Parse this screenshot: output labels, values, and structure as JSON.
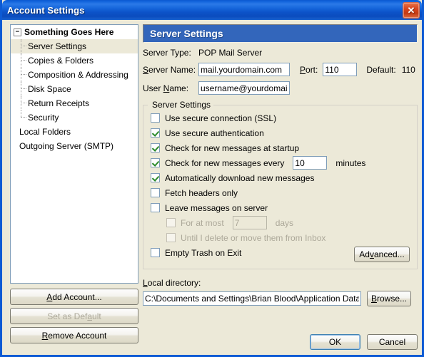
{
  "window": {
    "title": "Account Settings",
    "close_label": "✕"
  },
  "sidebar": {
    "tree": [
      {
        "label": "Something Goes Here",
        "level": 0,
        "bold": true,
        "expander": "−",
        "selected": false
      },
      {
        "label": "Server Settings",
        "level": 1,
        "bold": false,
        "selected": true
      },
      {
        "label": "Copies & Folders",
        "level": 1,
        "bold": false,
        "selected": false
      },
      {
        "label": "Composition & Addressing",
        "level": 1,
        "bold": false,
        "selected": false
      },
      {
        "label": "Disk Space",
        "level": 1,
        "bold": false,
        "selected": false
      },
      {
        "label": "Return Receipts",
        "level": 1,
        "bold": false,
        "selected": false
      },
      {
        "label": "Security",
        "level": 1,
        "bold": false,
        "selected": false
      },
      {
        "label": "Local Folders",
        "level": 0,
        "bold": false,
        "selected": false
      },
      {
        "label": "Outgoing Server (SMTP)",
        "level": 0,
        "bold": false,
        "selected": false
      }
    ],
    "buttons": {
      "add_account": "Add Account...",
      "set_as_default": "Set as Default",
      "remove_account": "Remove Account"
    }
  },
  "main": {
    "header": "Server Settings",
    "server_type_label": "Server Type:",
    "server_type_value": "POP Mail Server",
    "server_name_label": "Server Name:",
    "server_name_value": "mail.yourdomain.com",
    "port_label": "Port:",
    "port_value": "110",
    "default_label": "Default:",
    "default_value": "110",
    "user_name_label": "User Name:",
    "user_name_value": "username@yourdomain.",
    "groupbox_legend": "Server Settings",
    "options": [
      {
        "label": "Use secure connection (SSL)",
        "checked": false,
        "disabled": false,
        "indent": false
      },
      {
        "label": "Use secure authentication",
        "checked": true,
        "disabled": false,
        "indent": false
      },
      {
        "label": "Check for new messages at startup",
        "checked": true,
        "disabled": false,
        "indent": false
      },
      {
        "label": "Check for new messages every",
        "checked": true,
        "disabled": false,
        "indent": false,
        "field": "10",
        "suffix": "minutes"
      },
      {
        "label": "Automatically download new messages",
        "checked": true,
        "disabled": false,
        "indent": false
      },
      {
        "label": "Fetch headers only",
        "checked": false,
        "disabled": false,
        "indent": false
      },
      {
        "label": "Leave messages on server",
        "checked": false,
        "disabled": false,
        "indent": false
      },
      {
        "label": "For at most",
        "checked": false,
        "disabled": true,
        "indent": true,
        "field": "7",
        "suffix": "days"
      },
      {
        "label": "Until I delete or move them from Inbox",
        "checked": false,
        "disabled": true,
        "indent": true
      },
      {
        "label": "Empty Trash on Exit",
        "checked": false,
        "disabled": false,
        "indent": false
      }
    ],
    "advanced_button": "Advanced...",
    "local_directory_label": "Local directory:",
    "local_directory_value": "C:\\Documents and Settings\\Brian Blood\\Application Data\\Thunderbird\\Profiles",
    "browse_button": "Browse..."
  },
  "footer": {
    "ok": "OK",
    "cancel": "Cancel"
  },
  "colors": {
    "titlebar_blue": "#0c5ad4",
    "header_blue": "#3366bb",
    "face": "#ece9d8",
    "check_green": "#2a8a2a",
    "input_border": "#7f9db9",
    "disabled_text": "#aca899"
  }
}
